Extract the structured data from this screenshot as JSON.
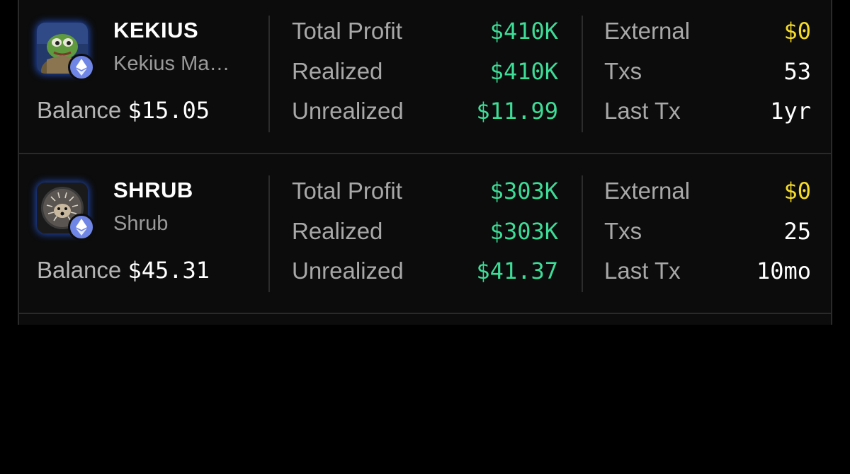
{
  "rows": [
    {
      "symbol": "KEKIUS",
      "name": "Kekius Ma…",
      "balance_label": "Balance",
      "balance": "$15.05",
      "total_profit_label": "Total Profit",
      "total_profit": "$410K",
      "realized_label": "Realized",
      "realized": "$410K",
      "unrealized_label": "Unrealized",
      "unrealized": "$11.99",
      "external_label": "External",
      "external": "$0",
      "txs_label": "Txs",
      "txs": "53",
      "last_tx_label": "Last Tx",
      "last_tx": "1yr",
      "avatar_icon": "pepe-token-icon",
      "chain_icon": "ethereum-icon"
    },
    {
      "symbol": "SHRUB",
      "name": "Shrub",
      "balance_label": "Balance",
      "balance": "$45.31",
      "total_profit_label": "Total Profit",
      "total_profit": "$303K",
      "realized_label": "Realized",
      "realized": "$303K",
      "unrealized_label": "Unrealized",
      "unrealized": "$41.37",
      "external_label": "External",
      "external": "$0",
      "txs_label": "Txs",
      "txs": "25",
      "last_tx_label": "Last Tx",
      "last_tx": "10mo",
      "avatar_icon": "hedgehog-token-icon",
      "chain_icon": "ethereum-icon"
    }
  ],
  "colors": {
    "profit_green": "#3ddc97",
    "external_yellow": "#f5dc2b",
    "label_gray": "#a8a8a8",
    "avatar_glow": "#2860dc",
    "eth_badge": "#6f86e6"
  }
}
